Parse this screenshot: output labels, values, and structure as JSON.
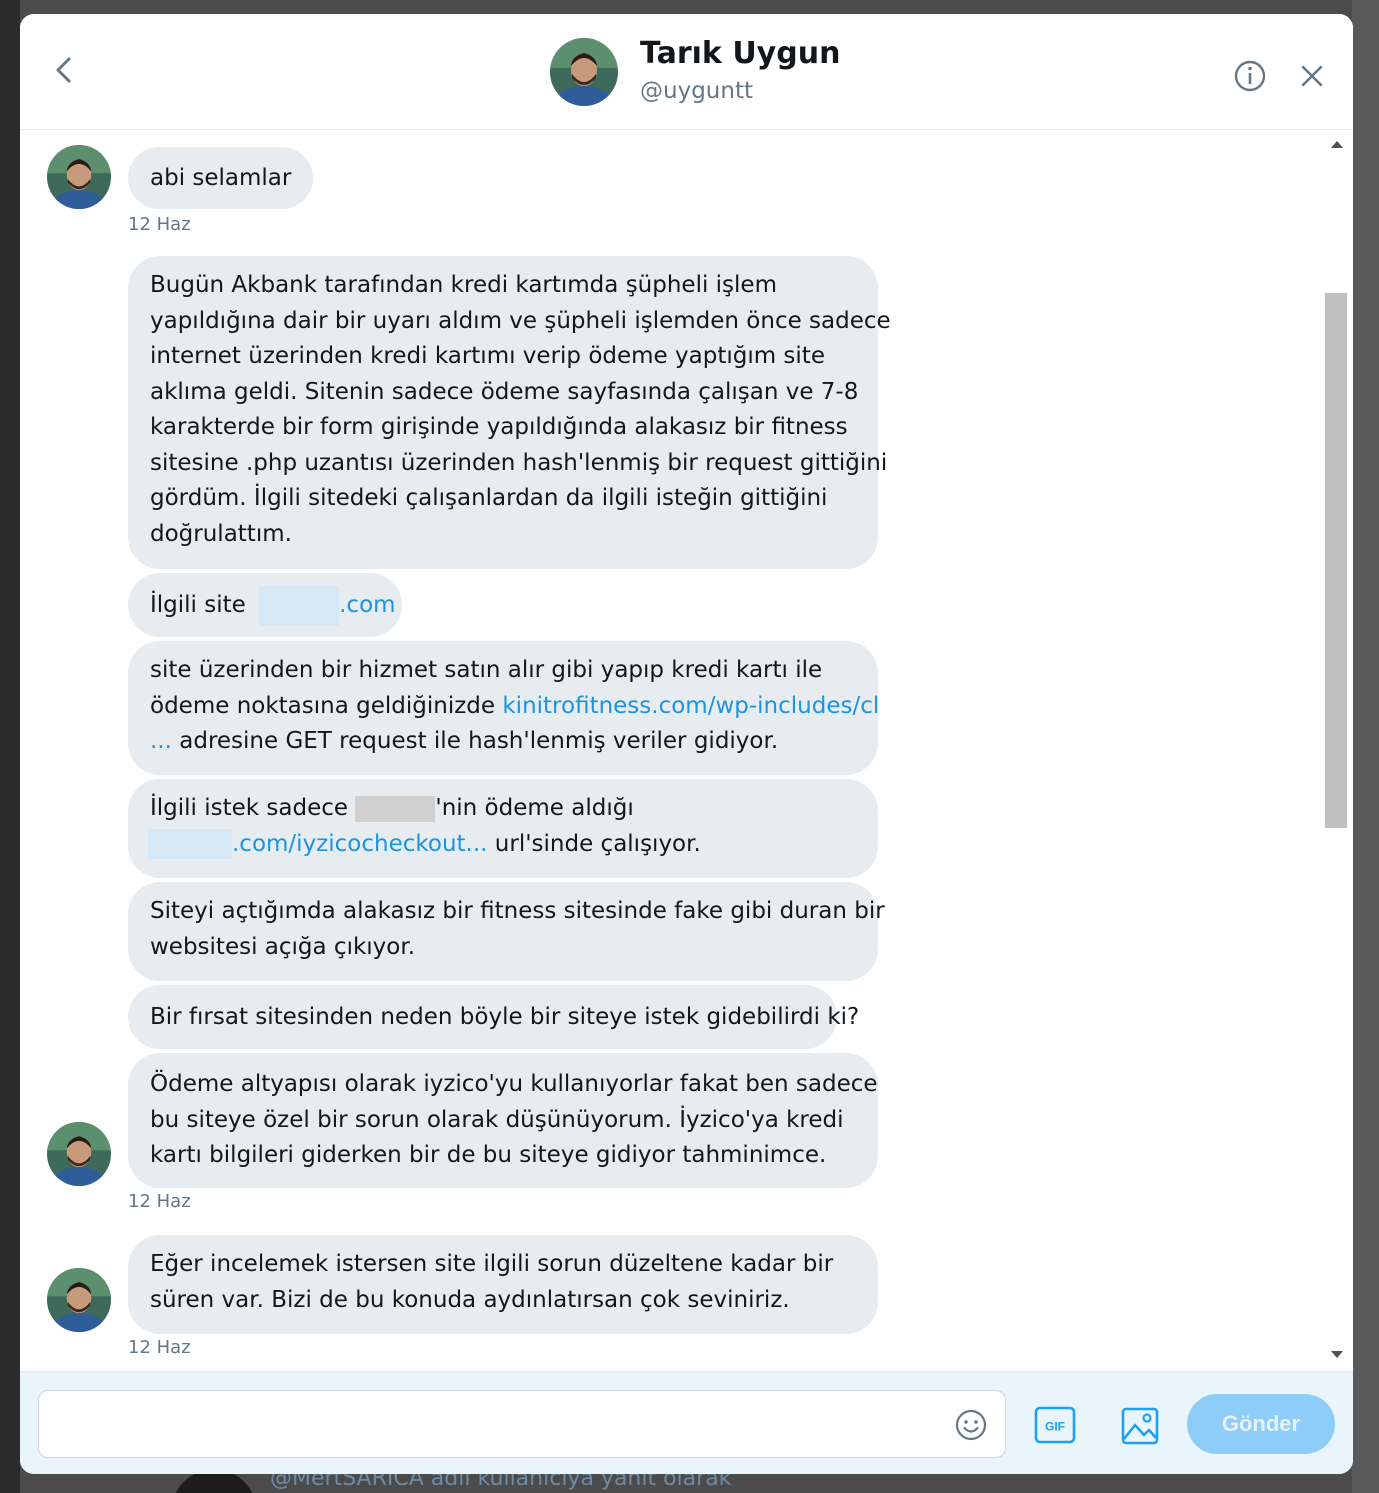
{
  "colors": {
    "bubble_bg": "#e6ecf0",
    "link": "#1b95e0",
    "send_button": "#8ecdf8",
    "composer_bg": "#eaf4fb"
  },
  "header": {
    "back_icon": "chevron-left-icon",
    "name": "Tarık Uygun",
    "handle": "@uyguntt",
    "info_icon": "info-icon",
    "close_icon": "close-icon"
  },
  "messages": [
    {
      "lines": [
        "abi selamlar"
      ],
      "timestamp": "12 Haz"
    },
    {
      "lines": [
        "Bugün Akbank tarafından kredi kartımda şüpheli işlem",
        "yapıldığına dair bir uyarı aldım ve şüpheli işlemden önce sadece",
        "internet üzerinden kredi kartımı verip ödeme yaptığım site",
        "aklıma geldi. Sitenin sadece ödeme sayfasında çalışan ve 7-8",
        "karakterde bir form girişinde yapıldığında alakasız bir fitness",
        "sitesine .php uzantısı üzerinden hash'lenmiş bir request gittiğini",
        "gördüm. İlgili sitedeki çalışanlardan da ilgili isteğin gittiğini",
        "doğrulattım."
      ]
    },
    {
      "prefix": "İlgili site",
      "link_suffix": ".com"
    },
    {
      "line1": "site üzerinden bir hizmet satın alır gibi yapıp kredi kartı ile",
      "line2_text": "ödeme noktasına geldiğinizde ",
      "line2_link": "kinitrofitness.com/wp-includes/cl",
      "line3_link": "...",
      "line3_text": " adresine GET request ile hash'lenmiş veriler gidiyor."
    },
    {
      "line1_prefix": "İlgili istek sadece ",
      "line1_suffix": "'nin ödeme aldığı",
      "line2_link": ".com/iyzicocheckout...",
      "line2_text": " url'sinde çalışıyor."
    },
    {
      "lines": [
        "Siteyi açtığımda alakasız bir fitness sitesinde fake gibi duran bir",
        "websitesi açığa çıkıyor."
      ]
    },
    {
      "lines": [
        "Bir fırsat sitesinden neden böyle bir siteye istek gidebilirdi ki?"
      ]
    },
    {
      "lines": [
        "Ödeme altyapısı olarak iyzico'yu kullanıyorlar fakat ben sadece",
        "bu siteye özel bir sorun olarak düşünüyorum. İyzico'ya kredi",
        "kartı bilgileri giderken bir de bu siteye gidiyor tahminimce."
      ],
      "timestamp": "12 Haz"
    },
    {
      "lines": [
        "Eğer incelemek istersen site ilgili sorun düzeltene kadar bir",
        "süren var. Bizi de bu konuda aydınlatırsan çok seviniriz."
      ],
      "timestamp": "12 Haz"
    }
  ],
  "composer": {
    "placeholder": "",
    "emoji_icon": "emoji-icon",
    "gif_label": "GIF",
    "image_icon": "image-icon",
    "send_label": "Gönder"
  },
  "background": {
    "text": "@MertSARICA adlı kullanıcıya yanıt olarak"
  }
}
